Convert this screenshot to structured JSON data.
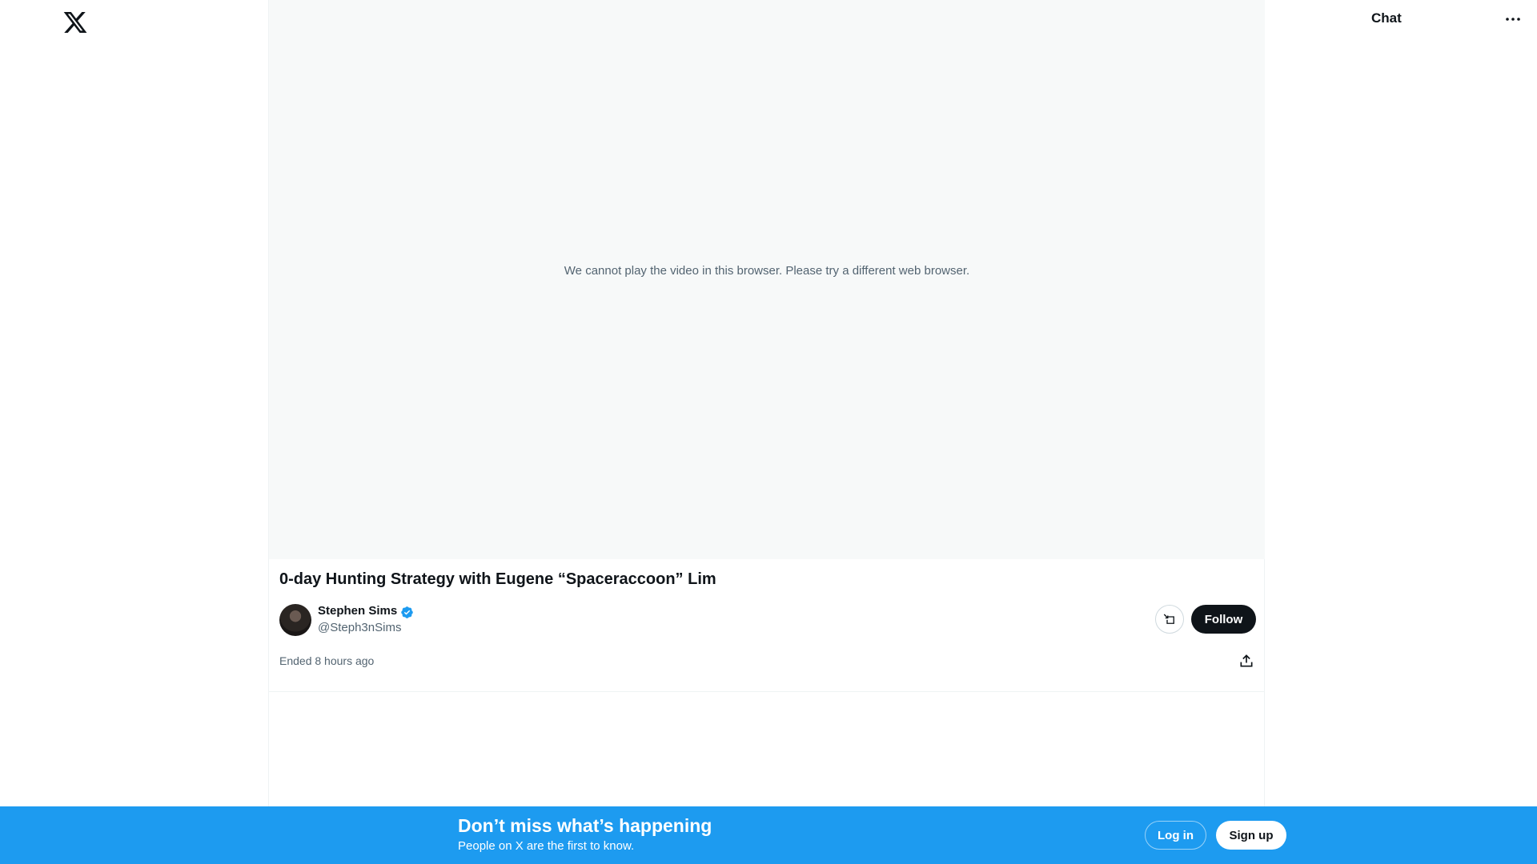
{
  "header": {
    "logo_icon": "x-logo-icon"
  },
  "video": {
    "message": "We cannot play the video in this browser. Please try a different web browser."
  },
  "space": {
    "title": "0-day Hunting Strategy with Eugene “Spaceraccoon” Lim",
    "host": {
      "name": "Stephen Sims",
      "handle": "@Steph3nSims",
      "verified": true
    },
    "follow_label": "Follow",
    "status": "Ended 8 hours ago"
  },
  "sidebar_right": {
    "chat_label": "Chat"
  },
  "bottom_bar": {
    "headline": "Don’t miss what’s happening",
    "subtext": "People on X are the first to know.",
    "login_label": "Log in",
    "signup_label": "Sign up"
  },
  "colors": {
    "brand_blue": "#1d9bf0",
    "text": "#0f1419",
    "muted": "#536471",
    "verified": "#1d9bf0"
  }
}
